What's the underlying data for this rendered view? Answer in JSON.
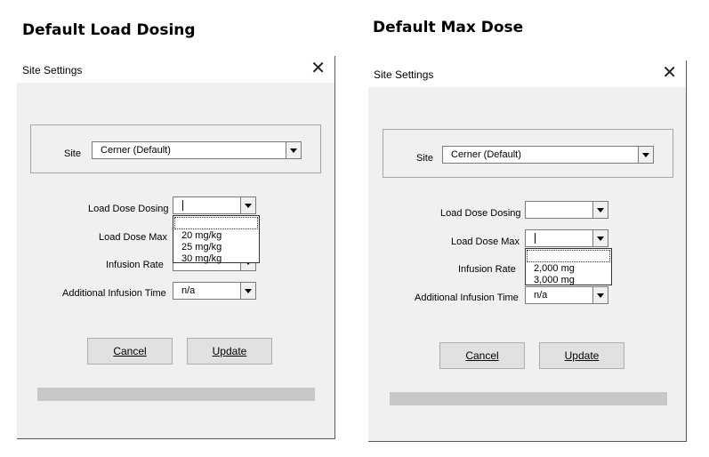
{
  "left_panel": {
    "heading": "Default Load Dosing",
    "dialog": {
      "title": "Site Settings",
      "close_glyph": "✕",
      "site_label": "Site",
      "site_value": "Cerner (Default)",
      "load_dose_dosing_label": "Load Dose Dosing",
      "load_dose_dosing_value": "",
      "load_dose_max_label": "Load Dose Max",
      "infusion_rate_label": "Infusion Rate",
      "additional_infusion_time_label": "Additional Infusion Time",
      "additional_infusion_time_value": "n/a",
      "dropdown_options": [
        "20 mg/kg",
        "25 mg/kg",
        "30 mg/kg"
      ],
      "cancel_label": "Cancel",
      "update_label": "Update"
    }
  },
  "right_panel": {
    "heading": "Default Max Dose",
    "dialog": {
      "title": "Site Settings",
      "close_glyph": "✕",
      "site_label": "Site",
      "site_value": "Cerner (Default)",
      "load_dose_dosing_label": "Load Dose Dosing",
      "load_dose_dosing_value": "",
      "load_dose_max_label": "Load Dose Max",
      "load_dose_max_value": "",
      "infusion_rate_label": "Infusion Rate",
      "additional_infusion_time_label": "Additional Infusion Time",
      "additional_infusion_time_value": "n/a",
      "dropdown_options": [
        "2,000 mg",
        "3,000 mg"
      ],
      "cancel_label": "Cancel",
      "update_label": "Update"
    }
  },
  "icons": {
    "close": "close-icon",
    "dropdown_arrow": "chevron-down-icon"
  },
  "colors": {
    "dialog_bg": "#f0f0f0",
    "progress_bar": "#c8c8c8",
    "button_bg": "#e1e1e1"
  }
}
